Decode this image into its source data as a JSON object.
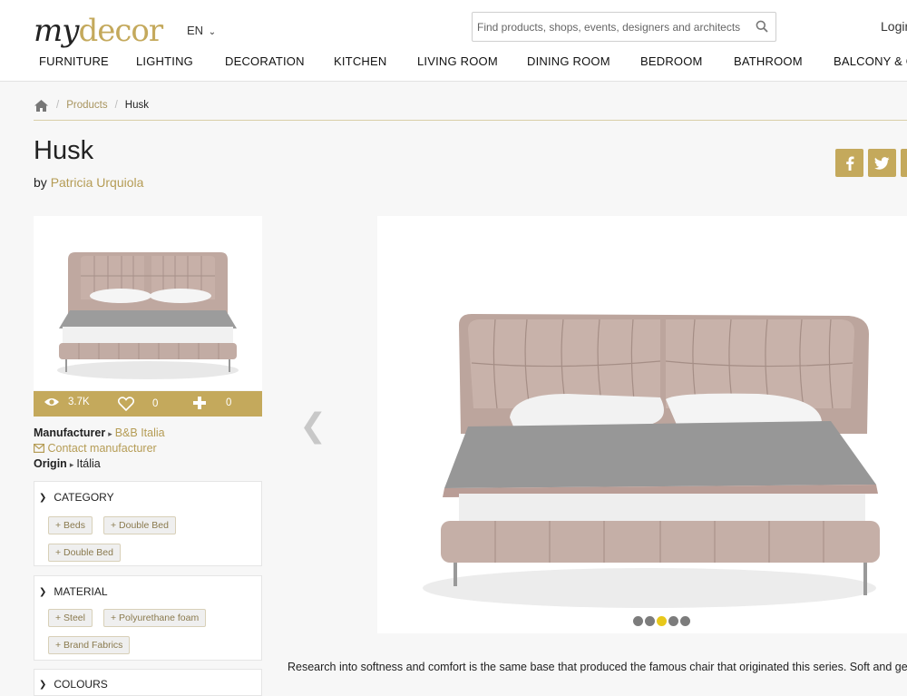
{
  "header": {
    "logo_my": "my",
    "logo_decor": "decor",
    "language": "EN",
    "search_placeholder": "Find products, shops, events, designers and architects",
    "login": "Login"
  },
  "nav": [
    "FURNITURE",
    "LIGHTING",
    "DECORATION",
    "KITCHEN",
    "LIVING ROOM",
    "DINING ROOM",
    "BEDROOM",
    "BATHROOM",
    "BALCONY & GA"
  ],
  "breadcrumb": {
    "products": "Products",
    "sep": "/",
    "current": "Husk"
  },
  "product": {
    "title": "Husk",
    "by": "by",
    "designer": "Patricia Urquiola",
    "stats": {
      "views": "3.7K",
      "likes": "0",
      "adds": "0"
    },
    "manufacturer_label": "Manufacturer",
    "manufacturer": "B&B Italia",
    "contact": "Contact manufacturer",
    "origin_label": "Origin",
    "origin": "Itália"
  },
  "filters": {
    "category": {
      "title": "CATEGORY",
      "tags": [
        "+ Beds",
        "+ Double Bed",
        "+ Double Bed"
      ]
    },
    "material": {
      "title": "MATERIAL",
      "tags": [
        "+ Steel",
        "+ Polyurethane foam",
        "+ Brand Fabrics"
      ]
    },
    "next_title": "COLOURS"
  },
  "gallery": {
    "slides": 5,
    "active": 2
  },
  "description": "Research into softness and comfort is the same base that produced the famous chair that originated this series. Soft and geometric",
  "colors": {
    "accent": "#c4a95c",
    "active_dot": "#e8c81b"
  }
}
